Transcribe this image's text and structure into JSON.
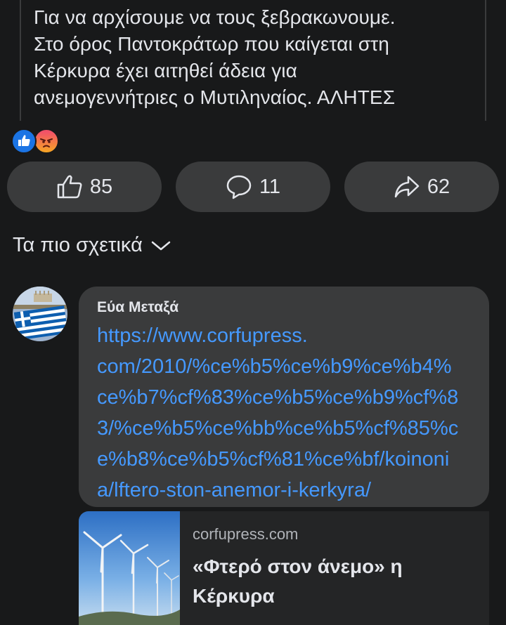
{
  "post": {
    "lines": [
      "Για να αρχίσουμε να τους ξεβρακωνουμε.",
      "Στο όρος Παντοκράτωρ που καίγεται στη",
      "Κέρκυρα έχει αιτηθεί άδεια για",
      "ανεμογεννήτριες ο Μυτιληναίος. ΑΛΗΤΕΣ"
    ]
  },
  "reactions": [
    "like",
    "angry"
  ],
  "actions": {
    "like_count": "85",
    "comment_count": "11",
    "share_count": "62"
  },
  "comments_sort": {
    "label": "Τα πιο σχετικά"
  },
  "comment": {
    "author": "Εύα Μεταξά",
    "link_lines": [
      "https://www.corfupress.",
      "com/2010/%ce%b5%ce%b9%ce%b4%",
      "ce%b7%cf%83%ce%b5%ce%b9%cf%8",
      "3/%ce%b5%ce%bb%ce%b5%cf%85%c",
      "e%b8%ce%b5%cf%81%ce%bf/koinoni",
      "a/lftero-ston-anemor-i-kerkyra/"
    ],
    "preview": {
      "domain": "corfupress.com",
      "title_lines": [
        "«Φτερό στον άνεμο» η",
        "Κέρκυρα"
      ]
    }
  },
  "colors": {
    "background": "#18191a",
    "surface": "#3a3b3c",
    "link": "#4599ff",
    "like_blue": "#1b74e4"
  }
}
